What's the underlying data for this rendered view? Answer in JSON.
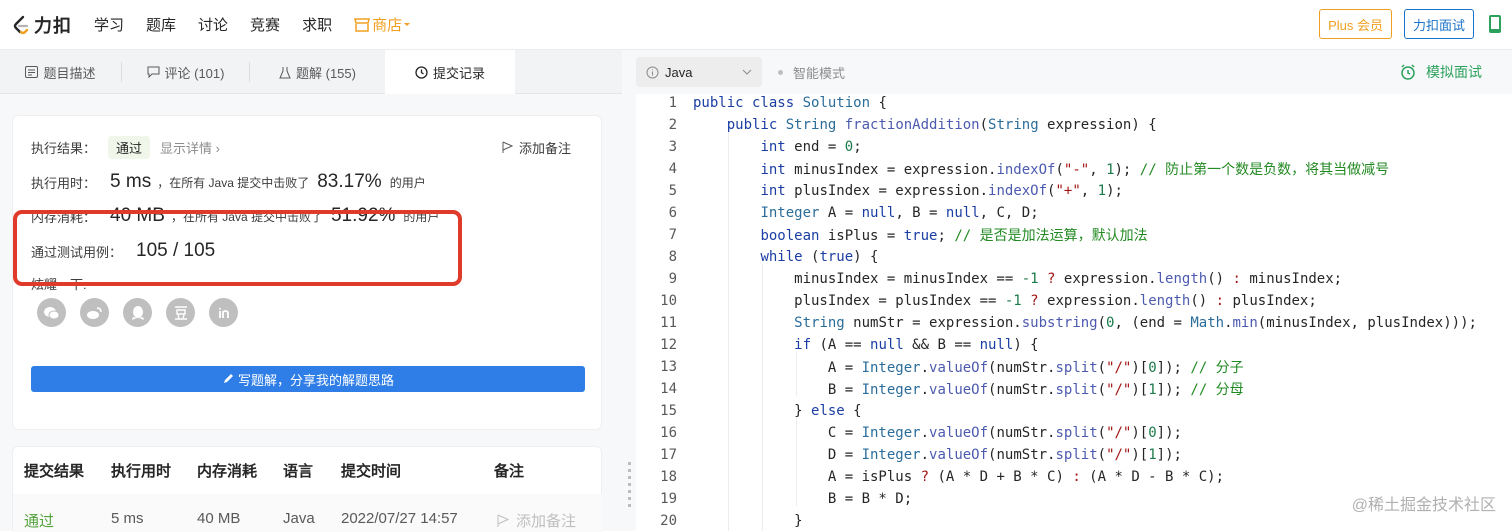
{
  "topbar": {
    "logo_name": "力扣",
    "nav": [
      "学习",
      "题库",
      "讨论",
      "竞赛",
      "求职"
    ],
    "store": "商店",
    "plus_label": "Plus 会员",
    "interview_label": "力扣面试"
  },
  "tabs": [
    {
      "label": "题目描述",
      "icon": "doc-icon"
    },
    {
      "label": "评论 (101)",
      "icon": "comment-icon"
    },
    {
      "label": "题解 (155)",
      "icon": "flask-icon"
    },
    {
      "label": "提交记录",
      "icon": "clock-icon"
    }
  ],
  "result": {
    "label": "执行结果：",
    "status": "通过",
    "detail_link": "显示详情 ›",
    "add_note": "添加备注",
    "time_label": "执行用时：",
    "time_value": "5 ms",
    "time_prefix": "，在所有 Java 提交中击败了",
    "time_pct": "83.17%",
    "time_suffix": "的用户",
    "mem_label": "内存消耗：",
    "mem_value": "40 MB",
    "mem_prefix": "，在所有 Java 提交中击败了",
    "mem_pct": "51.92%",
    "mem_suffix": "的用户",
    "tests_label": "通过测试用例：",
    "tests_value": "105 / 105",
    "share_label": "炫耀一下:",
    "share_icons": [
      "wechat-icon",
      "weibo-icon",
      "qq-icon",
      "douban-icon",
      "linkedin-icon"
    ],
    "write_button": "写题解，分享我的解题思路"
  },
  "submissions": {
    "headers": [
      "提交结果",
      "执行用时",
      "内存消耗",
      "语言",
      "提交时间",
      "备注"
    ],
    "rows": [
      {
        "status": "通过",
        "time": "5 ms",
        "memory": "40 MB",
        "lang": "Java",
        "submitted": "2022/07/27 14:57",
        "note": "添加备注"
      }
    ]
  },
  "editor": {
    "language": "Java",
    "smart_mode": "智能模式",
    "mock_interview": "模拟面试"
  },
  "watermark": "@稀土掘金技术社区",
  "accent_colors": {
    "blue": "#2f7ee8",
    "green": "#2ca15c",
    "orange": "#f0a020",
    "highlight": "#e03a2a"
  }
}
